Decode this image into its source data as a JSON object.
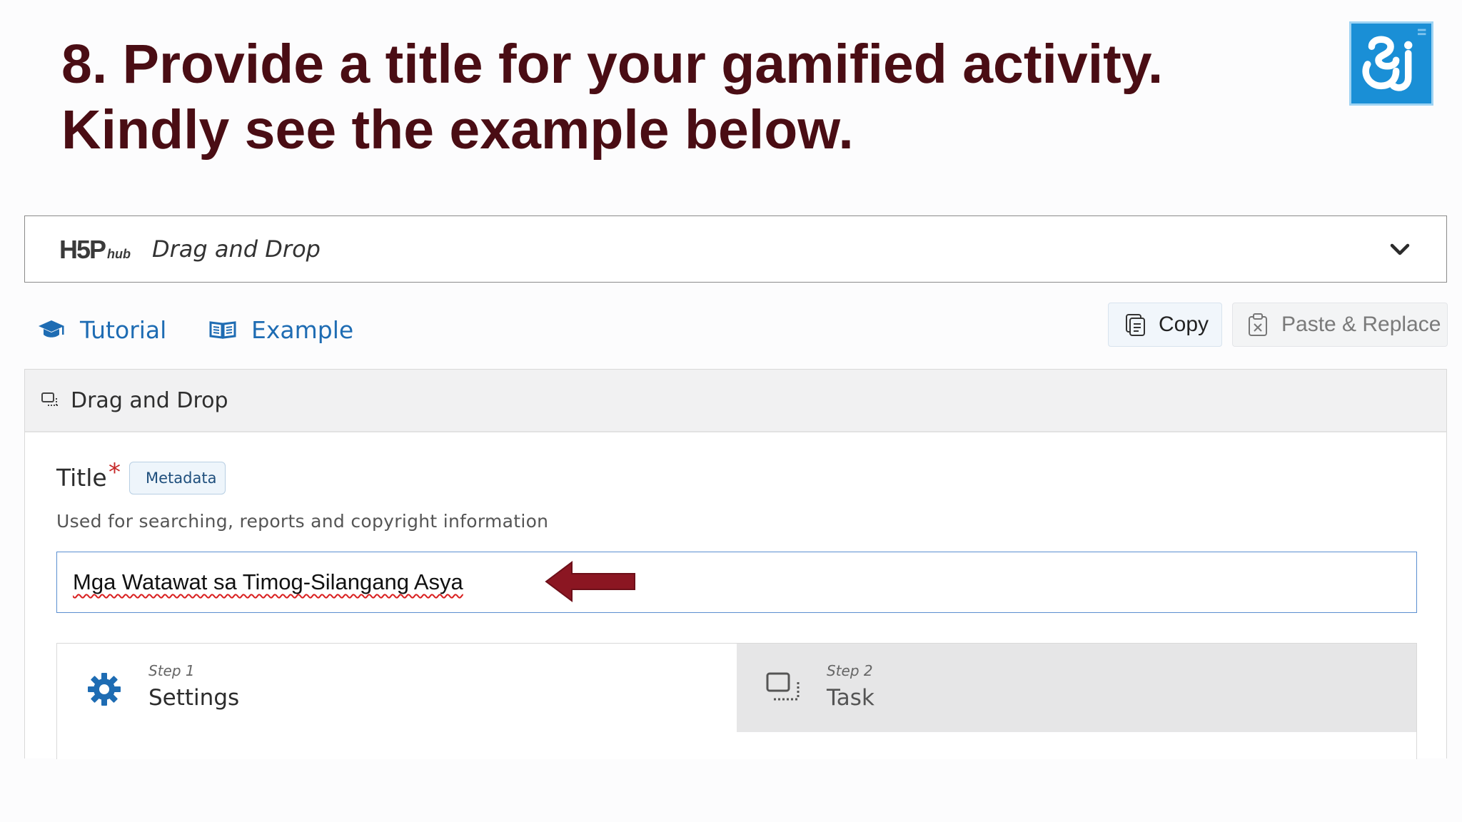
{
  "slide": {
    "title": "8. Provide a title for your gamified activity. Kindly see the example below.",
    "logo_icon": "school-logo-icon"
  },
  "hub": {
    "logo_main": "H5P",
    "logo_sub": "hub",
    "content_type": "Drag and Drop",
    "expand_icon": "chevron-down-icon"
  },
  "links": {
    "tutorial": "Tutorial",
    "example": "Example",
    "color": "#1e6cb3"
  },
  "toolbar": {
    "copy_label": "Copy",
    "paste_label": "Paste & Replace"
  },
  "panel": {
    "header_title": "Drag and Drop",
    "field": {
      "label": "Title",
      "required_mark": "*",
      "metadata_label": "Metadata",
      "description": "Used for searching, reports and copyright information",
      "value": "Mga Watawat sa Timog-Silangang Asya"
    },
    "steps": [
      {
        "kicker": "Step 1",
        "name": "Settings",
        "icon": "gear-icon",
        "active": true
      },
      {
        "kicker": "Step 2",
        "name": "Task",
        "icon": "drag-drop-icon",
        "active": false
      }
    ]
  },
  "colors": {
    "title_text": "#4a0d14",
    "arrow": "#8b1622",
    "input_border": "#5b8fd0"
  }
}
